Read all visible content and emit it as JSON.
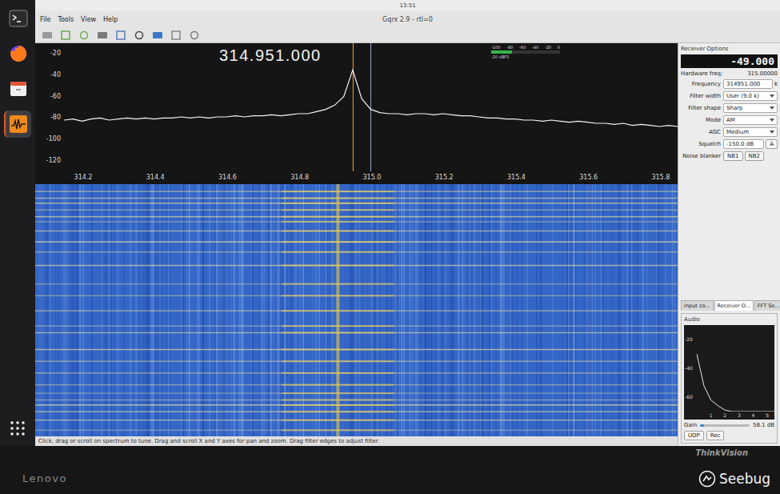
{
  "desktop": {
    "clock": "13:51",
    "dock": [
      {
        "selected": false
      },
      {
        "selected": false
      },
      {
        "selected": false
      },
      {
        "selected": true
      }
    ]
  },
  "window": {
    "title": "Gqrx 2.9 - rtl=0",
    "menu": [
      "File",
      "Tools",
      "View",
      "Help"
    ]
  },
  "spectrum": {
    "frequency": "314.951.000",
    "y_ticks": [
      "-20",
      "-40",
      "-60",
      "-80",
      "-100",
      "-120"
    ],
    "x_ticks": [
      "314.2",
      "314.4",
      "314.6",
      "314.8",
      "315.0",
      "315.2",
      "315.4",
      "315.6",
      "315.8"
    ],
    "start_mhz": 314.15,
    "end_mhz": 315.85,
    "tuned_mhz": 314.951,
    "hardware_mhz": 315.0,
    "values": [
      -82,
      -81,
      -83,
      -81,
      -80,
      -82,
      -81,
      -80,
      -81,
      -80,
      -81,
      -80,
      -80,
      -79,
      -80,
      -79,
      -80,
      -79,
      -79,
      -78,
      -79,
      -78,
      -78,
      -77,
      -78,
      -77,
      -76,
      -76,
      -74,
      -72,
      -68,
      -60,
      -35,
      -62,
      -72,
      -75,
      -76,
      -76,
      -77,
      -76,
      -76,
      -77,
      -76,
      -77,
      -78,
      -78,
      -79,
      -80,
      -80,
      -81,
      -81,
      -82,
      -82,
      -83,
      -82,
      -83,
      -84,
      -83,
      -84,
      -85,
      -85,
      -86,
      -85,
      -87,
      -86,
      -87,
      -88,
      -87,
      -88
    ]
  },
  "meter": {
    "ticks": [
      "-100",
      "-80",
      "-60",
      "-40",
      "-20",
      "0"
    ],
    "level": 0.3,
    "reading": "-20 dBFS"
  },
  "receiver": {
    "title": "Receiver Options",
    "offset": "-49.000",
    "hardware_label": "Hardware freq:",
    "hardware_value": "315.00000",
    "fields": [
      {
        "kind": "spin",
        "label": "Frequency",
        "value": "314951.000",
        "unit": "k"
      },
      {
        "kind": "combo",
        "label": "Filter width",
        "value": "User (9.0 k)"
      },
      {
        "kind": "combo",
        "label": "Filter shape",
        "value": "Sharp"
      },
      {
        "kind": "combo",
        "label": "Mode",
        "value": "AM"
      },
      {
        "kind": "combo",
        "label": "AGC",
        "value": "Medium"
      },
      {
        "kind": "spin",
        "label": "Squelch",
        "value": "-150.0 dB",
        "button": "A"
      },
      {
        "kind": "toggles",
        "label": "Noise blanker",
        "buttons": [
          {
            "label": "NB1",
            "checked": false
          },
          {
            "label": "NB2",
            "checked": false
          }
        ]
      }
    ]
  },
  "tabs": [
    {
      "label": "Input co...",
      "selected": false
    },
    {
      "label": "Receiver O...",
      "selected": true
    },
    {
      "label": "FFT Se...",
      "selected": false
    }
  ],
  "audio": {
    "title": "Audio",
    "y_ticks": [
      "-20",
      "-40",
      "-60"
    ],
    "x_ticks": [
      "1",
      "2",
      "3",
      "4",
      "5"
    ],
    "values": [
      -30,
      -52,
      -62,
      -66,
      -69,
      -70,
      -70,
      -70,
      -70,
      -70,
      -70,
      -70
    ],
    "gain_label": "Gain",
    "gain_level": 0.08,
    "gain_reading": "58.1 dB",
    "buttons": [
      "UDP",
      "Rec"
    ]
  },
  "status_bar": "Click, drag or scroll on spectrum to tune. Drag and scroll X and Y axes for pan and zoom. Drag filter edges to adjust filter.",
  "monitor": {
    "brand": "Lenovo",
    "model": "ThinkVision"
  },
  "watermark": "Seebug"
}
